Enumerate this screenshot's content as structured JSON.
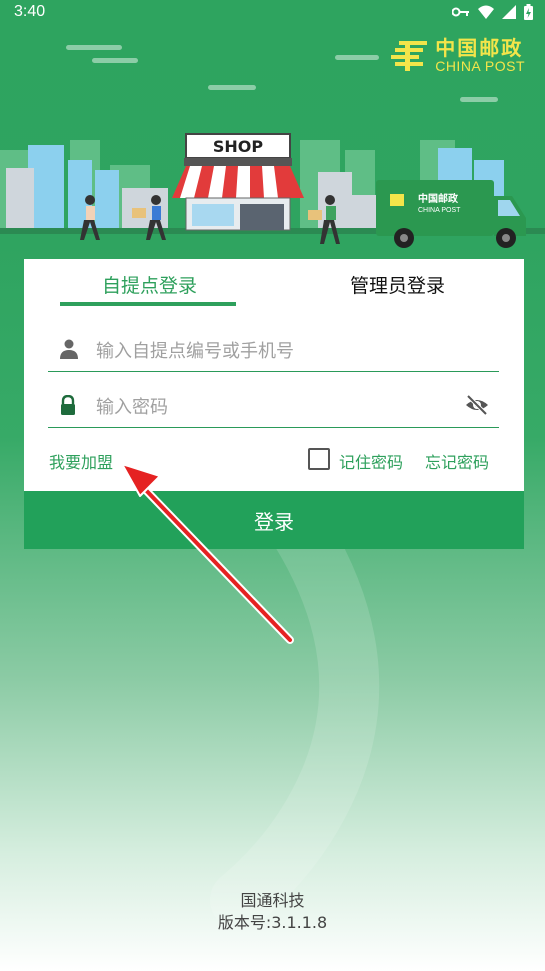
{
  "status_bar": {
    "time": "3:40"
  },
  "header": {
    "logo_cn": "中国邮政",
    "logo_en": "CHINA POST",
    "shop_sign": "SHOP",
    "truck_cn": "中国邮政",
    "truck_en": "CHINA POST"
  },
  "login": {
    "tabs": [
      {
        "label": "自提点登录",
        "active": true
      },
      {
        "label": "管理员登录",
        "active": false
      }
    ],
    "account_placeholder": "输入自提点编号或手机号",
    "password_placeholder": "输入密码",
    "join_label": "我要加盟",
    "remember_label": "记住密码",
    "remember_checked": false,
    "forgot_label": "忘记密码",
    "submit_label": "登录"
  },
  "footer": {
    "company": "国通科技",
    "version": "版本号:3.1.1.8"
  },
  "colors": {
    "brand_green": "#2ea05c",
    "button_green": "#22a15a",
    "logo_yellow": "#f3e54a",
    "annotation_red": "#e52222"
  }
}
